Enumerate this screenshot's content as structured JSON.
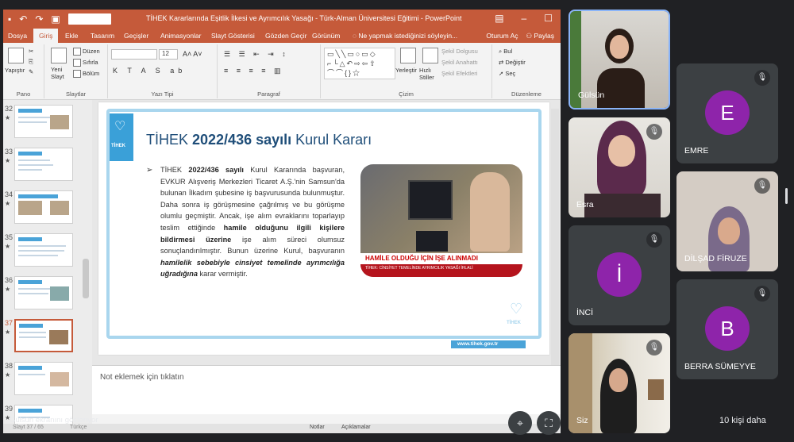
{
  "ppt": {
    "title": "TİHEK Kararlarında Eşitlik İlkesi ve Ayrımcılık Yasağı - Türk-Alman Üniversitesi Eğitimi - PowerPoint",
    "tabs": [
      "Dosya",
      "Giriş",
      "Ekle",
      "Tasarım",
      "Geçişler",
      "Animasyonlar",
      "Slayt Gösterisi",
      "Gözden Geçir",
      "Görünüm"
    ],
    "tell_me": "Ne yapmak istediğinizi söyleyin...",
    "signin": "Oturum Aç",
    "share": "Paylaş",
    "ribbon": {
      "paste": "Yapıştır",
      "new_slide": "Yeni Slayt",
      "layout": "Düzen",
      "reset": "Sıfırla",
      "section": "Bölüm",
      "arrange": "Yerleştir",
      "quick_styles": "Hızlı Stiller",
      "shape_fill": "Şekil Dolgusu",
      "shape_outline": "Şekil Anahattı",
      "shape_effects": "Şekil Efektleri",
      "find": "Bul",
      "replace": "Değiştir",
      "select": "Seç",
      "font_size": "12",
      "groups": {
        "clipboard": "Pano",
        "slides": "Slaytlar",
        "font": "Yazı Tipi",
        "paragraph": "Paragraf",
        "drawing": "Çizim",
        "editing": "Düzenleme"
      }
    },
    "thumbnails": [
      {
        "num": "32"
      },
      {
        "num": "33"
      },
      {
        "num": "34"
      },
      {
        "num": "35"
      },
      {
        "num": "36"
      },
      {
        "num": "37"
      },
      {
        "num": "38"
      },
      {
        "num": "39"
      }
    ],
    "slide": {
      "title_pre": "TİHEK ",
      "title_bold": "2022/436 sayılı",
      "title_post": " Kurul Kararı",
      "logo_text": "TİHEK",
      "body_1": "TİHEK ",
      "body_2": "2022/436 sayılı",
      "body_3": " Kurul Kararında başvuran, EVKUR Alışveriş Merkezleri Ticaret A.Ş.'nin Samsun'da bulunan İlkadım şubesine iş başvurusunda bulunmuştur. Daha sonra iş görüşmesine çağrılmış ve bu görüşme olumlu geçmiştir. Ancak, işe alım evraklarını toparlayıp teslim ettiğinde ",
      "body_4": "hamile olduğunu ilgili kişilere bildirmesi üzerine",
      "body_5": " işe alım süreci olumsuz sonuçlandırılmıştır. Bunun üzerine Kurul, başvuranın ",
      "body_6": "hamilelik sebebiyle cinsiyet temelinde ayrımcılığa uğradığına",
      "body_7": " karar vermiştir.",
      "news_caption": "HAMİLE OLDUĞU İÇİN İŞE ALINMADI",
      "news_ticker": "TİHEK: CİNSİYET TEMELİNDE AYRIMCILIK YASAĞI İHLALİ",
      "footer_url": "www.tihek.gov.tr"
    },
    "notes_placeholder": "Not eklemek için tıklatın",
    "status": {
      "slide": "Slayt 37 / 65",
      "language": "Türkçe",
      "notes": "Notlar",
      "comments": "Açıklamalar"
    }
  },
  "presenter_banner": "Gülsün ekranını gösteriyor",
  "participants": [
    {
      "name": "Gülsün",
      "type": "video"
    },
    {
      "name": "EMRE",
      "type": "avatar",
      "initial": "E",
      "color": "#8e24aa"
    },
    {
      "name": "Esra",
      "type": "video"
    },
    {
      "name": "DİLŞAD FİRUZE",
      "type": "video"
    },
    {
      "name": "İNCİ",
      "type": "avatar",
      "initial": "İ",
      "color": "#8e24aa"
    },
    {
      "name": "BERRA SÜMEYYE",
      "type": "avatar",
      "initial": "B",
      "color": "#8e24aa"
    },
    {
      "name": "Siz",
      "type": "video"
    }
  ],
  "more_people": "10 kişi daha"
}
